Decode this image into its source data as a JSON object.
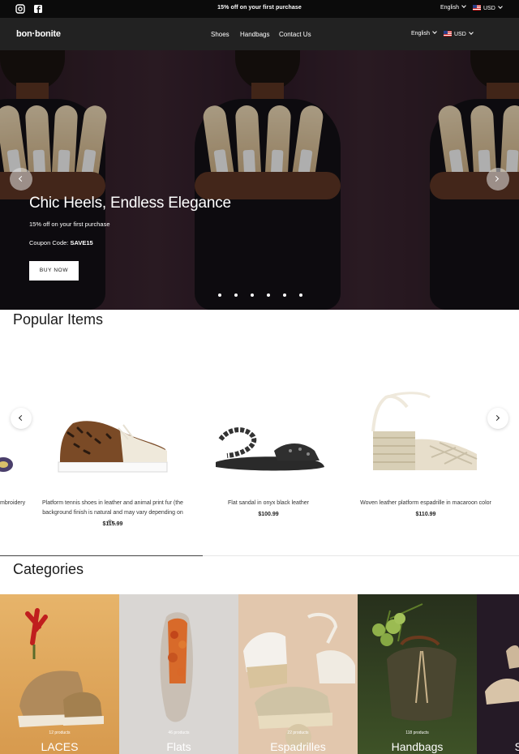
{
  "announcement": {
    "message": "15% off on your first purchase",
    "language": "English",
    "currency": "USD",
    "social": [
      "instagram-icon",
      "facebook-icon"
    ]
  },
  "header": {
    "logo": "bon·bonite",
    "nav": [
      "Shoes",
      "Handbags",
      "Contact Us"
    ],
    "language": "English",
    "currency": "USD"
  },
  "hero": {
    "title": "Chic Heels, Endless Elegance",
    "subtitle": "15% off on your first purchase",
    "coupon_label": "Coupon Code:",
    "coupon_code": "SAVE15",
    "button": "BUY NOW",
    "slides": 6,
    "active_slide": 1
  },
  "popular": {
    "title": "Popular Items",
    "items": [
      {
        "name": "mbroidery",
        "price": ""
      },
      {
        "name": "Platform tennis shoes in leather and animal print fur (the background finish is natural and may vary depending on th...",
        "price": "$115.99"
      },
      {
        "name": "Flat sandal in onyx black leather",
        "price": "$100.99"
      },
      {
        "name": "Woven leather platform espadrille in macaroon color",
        "price": "$110.99"
      }
    ]
  },
  "categories": {
    "title": "Categories",
    "items": [
      {
        "count": "12 products",
        "name": "LACES"
      },
      {
        "count": "46 products",
        "name": "Flats"
      },
      {
        "count": "22 products",
        "name": "Espadrilles"
      },
      {
        "count": "118 products",
        "name": "Handbags"
      },
      {
        "count": "",
        "name": "S"
      }
    ]
  },
  "colors": {
    "announcement_bg": "#0b0b0b",
    "header_bg": "#222222",
    "accent_text": "#ffffff"
  }
}
